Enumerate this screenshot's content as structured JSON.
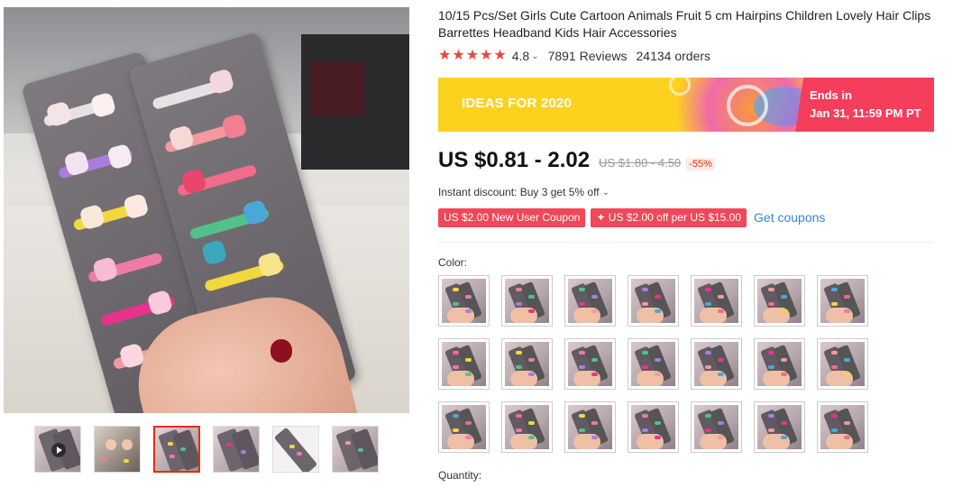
{
  "product": {
    "title": "10/15 Pcs/Set Girls Cute Cartoon Animals Fruit 5 cm Hairpins Children Lovely Hair Clips Barrettes Headband Kids Hair Accessories",
    "rating": "4.8",
    "rating_stars": 5,
    "reviews": "7891 Reviews",
    "orders": "24134 orders"
  },
  "banner": {
    "text": "IDEAS FOR 2020",
    "ends_label": "Ends in",
    "ends_time": "Jan 31, 11:59 PM PT"
  },
  "price": {
    "current": "US $0.81 - 2.02",
    "original": "US $1.80 - 4.50",
    "discount": "-55%"
  },
  "instant_discount": "Instant discount: Buy 3 get 5% off",
  "coupons": [
    "US $2.00 New User Coupon",
    "✦ US $2.00 off per US $15.00"
  ],
  "get_coupons": "Get coupons",
  "color_label": "Color:",
  "quantity_label": "Quantity:",
  "colors": {
    "accent": "#e62e04",
    "coupon_bg": "#f0475a",
    "link": "#3286d1",
    "banner_yellow": "#fcd21f",
    "banner_red": "#f43e5b",
    "star": "#f2443b"
  },
  "icons": {
    "star": "star-icon",
    "chevron": "chevron-down-icon",
    "play": "play-icon"
  },
  "thumbnails": 6,
  "active_thumbnail": 3,
  "swatch_count": 21
}
